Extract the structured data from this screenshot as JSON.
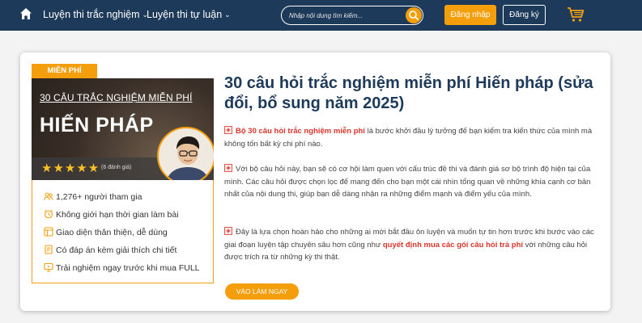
{
  "navbar": {
    "links": [
      {
        "label": "Luyện thi trắc nghiệm"
      },
      {
        "label": "Luyện thi tự luận"
      }
    ],
    "search_placeholder": "Nhập nội dung tìm kiếm...",
    "login_label": "Đăng nhập",
    "register_label": "Đăng ký",
    "accent_color": "#f59e0b",
    "bg_color": "#1e3a5a"
  },
  "product": {
    "badge": "MIỄN PHÍ",
    "thumbnail": {
      "subtitle": "30 CÂU TRẮC NGHIỆM MIỄN PHÍ",
      "heading": "HIẾN PHÁP",
      "stars": "★★★★★",
      "rating_count": "(6 đánh giá)"
    },
    "features": [
      {
        "icon": "users-icon",
        "text": "1,276+ người tham gia"
      },
      {
        "icon": "clock-icon",
        "text": "Không giới hạn thời gian làm bài"
      },
      {
        "icon": "layout-icon",
        "text": "Giao diện thân thiện, dễ dùng"
      },
      {
        "icon": "document-icon",
        "text": "Có đáp án kèm giải thích chi tiết"
      },
      {
        "icon": "monitor-icon",
        "text": "Trải nghiệm ngay trước khi mua FULL"
      }
    ],
    "title": "30 câu hỏi trắc nghiệm miễn phí Hiến pháp (sửa đổi, bổ sung năm 2025)",
    "paragraphs": {
      "p1_highlight": "Bộ 30 câu hỏi trắc nghiệm miễn phí",
      "p1_rest": " là bước khởi đầu lý tưởng để bạn kiểm tra kiến thức của mình mà không tốn bất kỳ chi phí nào.",
      "p2": "Với bộ câu hỏi này, bạn sẽ có cơ hội làm quen với cấu trúc đề thi và đánh giá sơ bộ trình độ hiện tại của mình. Các câu hỏi được chọn lọc để mang đến cho bạn một cái nhìn tổng quan về những khía cạnh cơ bản nhất của nội dung thi, giúp bạn dễ dàng nhận ra những điểm mạnh và điểm yếu của mình.",
      "p3_start": "Đây là lựa chọn hoàn hảo cho những ai mới bắt đầu ôn luyện và muốn tự tin hơn trước khi bước vào các giai đoạn luyện tập chuyên sâu hơn cũng như ",
      "p3_highlight": "quyết định mua các gói câu hỏi trả phí",
      "p3_end": " với những câu hỏi được trích ra từ những kỳ thi thật."
    },
    "cta_label": "VÀO LÀM NGAY",
    "highlight_color": "#d9342b"
  }
}
